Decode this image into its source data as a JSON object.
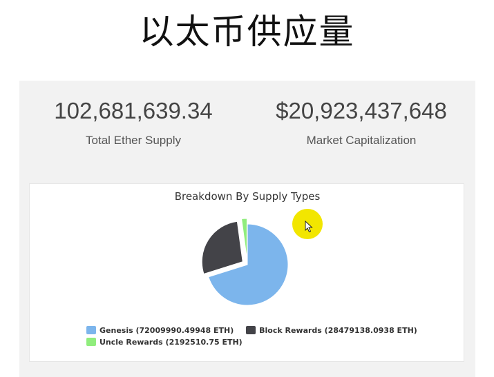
{
  "slide": {
    "title": "以太币供应量"
  },
  "stats": {
    "total_supply": {
      "value": "102,681,639.34",
      "label": "Total Ether Supply"
    },
    "market_cap": {
      "value": "$20,923,437,648",
      "label": "Market Capitalization"
    }
  },
  "colors": {
    "genesis": "#7cb5ec",
    "block_rewards": "#434348",
    "uncle_rewards": "#90ed7d",
    "cursor_highlight": "#f2e600"
  },
  "chart_data": {
    "type": "pie",
    "title": "Breakdown By Supply Types",
    "legend_position": "bottom",
    "series": [
      {
        "name": "Genesis",
        "value": 72009990.49948,
        "legend_label": "Genesis (72009990.49948 ETH)",
        "sliced": false
      },
      {
        "name": "Block Rewards",
        "value": 28479138.0938,
        "legend_label": "Block Rewards (28479138.0938 ETH)",
        "sliced": true
      },
      {
        "name": "Uncle Rewards",
        "value": 2192510.75,
        "legend_label": "Uncle Rewards (2192510.75 ETH)",
        "sliced": true
      }
    ]
  }
}
